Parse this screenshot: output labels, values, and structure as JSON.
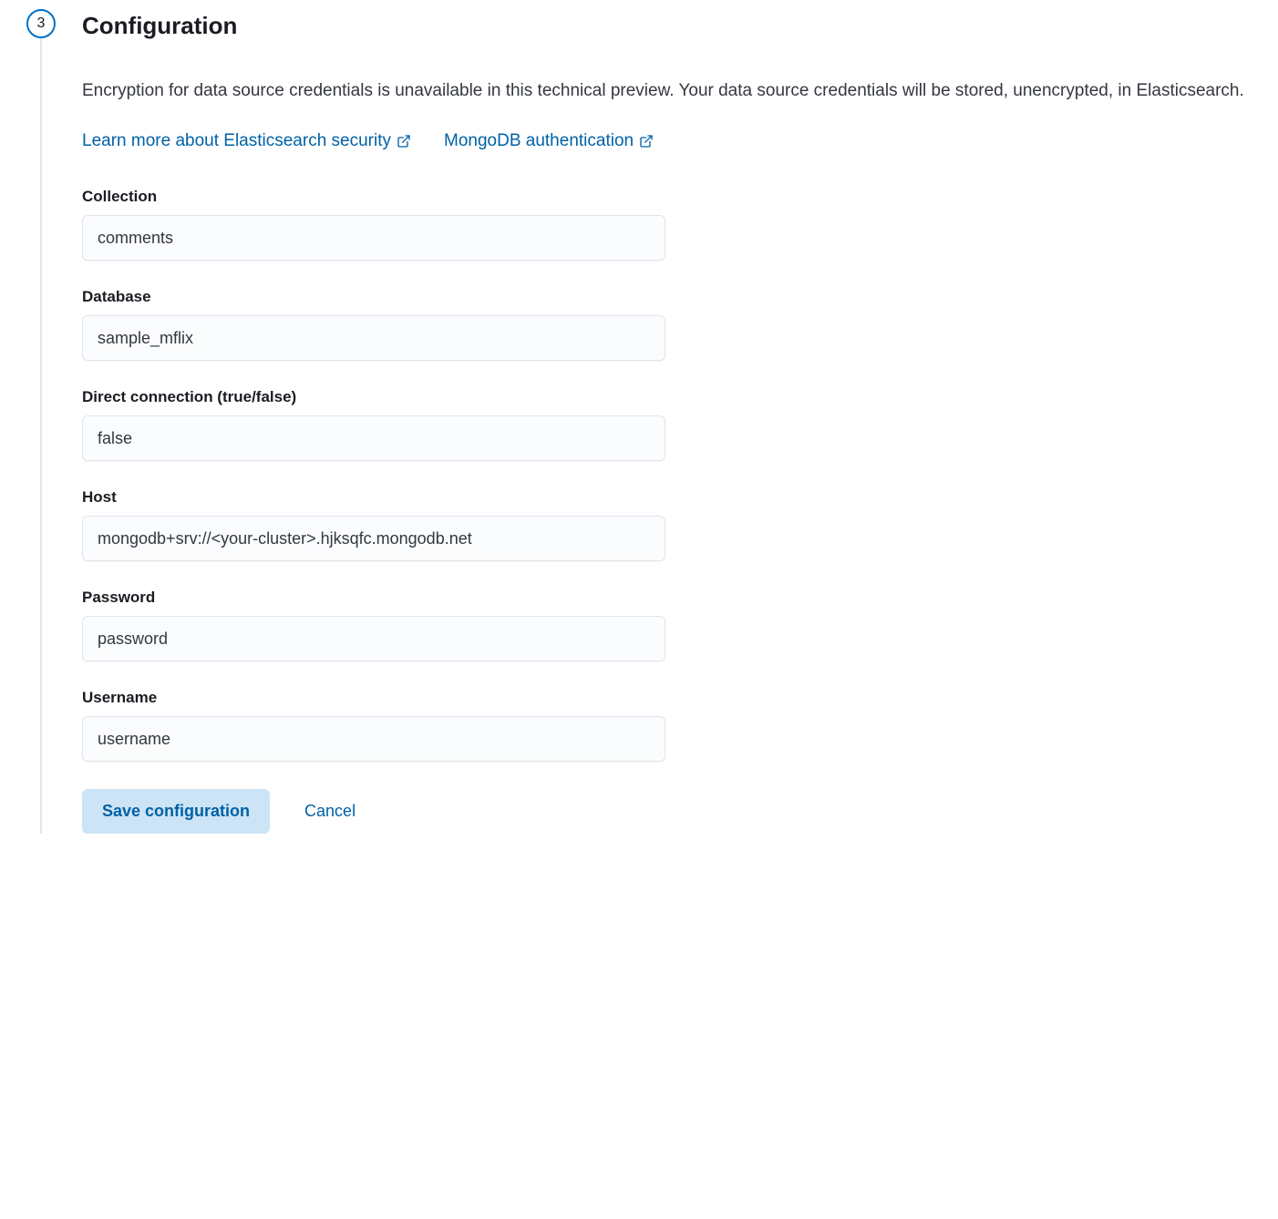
{
  "step": {
    "number": "3",
    "title": "Configuration"
  },
  "description": "Encryption for data source credentials is unavailable in this technical preview. Your data source credentials will be stored, unencrypted, in Elasticsearch.",
  "links": {
    "elasticsearch_security": "Learn more about Elasticsearch security",
    "mongodb_auth": "MongoDB authentication"
  },
  "fields": {
    "collection": {
      "label": "Collection",
      "value": "comments"
    },
    "database": {
      "label": "Database",
      "value": "sample_mflix"
    },
    "direct_connection": {
      "label": "Direct connection (true/false)",
      "value": "false"
    },
    "host": {
      "label": "Host",
      "value": "mongodb+srv://<your-cluster>.hjksqfc.mongodb.net"
    },
    "password": {
      "label": "Password",
      "value": "password"
    },
    "username": {
      "label": "Username",
      "value": "username"
    }
  },
  "buttons": {
    "save": "Save configuration",
    "cancel": "Cancel"
  }
}
